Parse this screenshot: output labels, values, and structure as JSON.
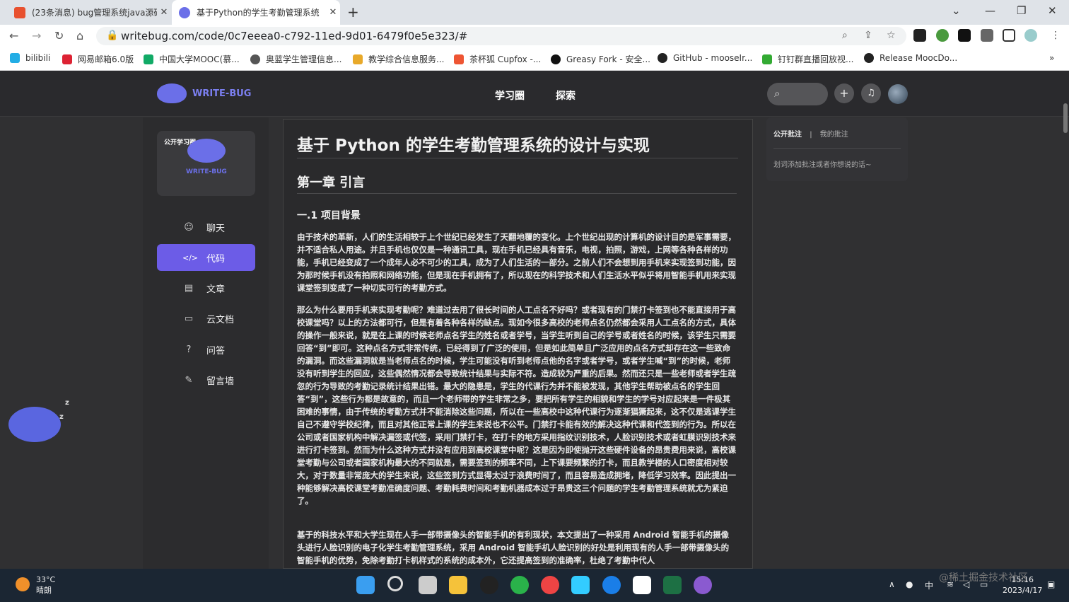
{
  "browser": {
    "tabs": [
      {
        "title": "(23条消息) bug管理系统java源码",
        "close": "✕"
      },
      {
        "title": "基于Python的学生考勤管理系统",
        "close": "✕"
      }
    ],
    "new_tab": "+",
    "url": "writebug.com/code/0c7eeea0-c792-11ed-9d01-6479f0e5e323/#",
    "bookmarks": [
      "bilibili",
      "网易邮箱6.0版",
      "中国大学MOOC(慕...",
      "奥蓝学生管理信息...",
      "教学综合信息服务...",
      "茶杯狐 Cupfox -...",
      "Greasy Fork - 安全...",
      "GitHub - mooseIr...",
      "钉钉群直播回放视...",
      "Release MoocDo..."
    ],
    "bookmarks_more": "»"
  },
  "site": {
    "logo_text": "WRITE-BUG",
    "nav": [
      "学习圈",
      "探索"
    ],
    "plus": "+",
    "bell": "🔔"
  },
  "sidebar": {
    "card_tag": "公开学习圈",
    "card_logo": "WRITE-BUG",
    "items": [
      {
        "label": "聊天",
        "icon": "chat-icon",
        "glyph": "☺"
      },
      {
        "label": "代码",
        "icon": "code-icon",
        "glyph": "</>"
      },
      {
        "label": "文章",
        "icon": "article-icon",
        "glyph": "▤"
      },
      {
        "label": "云文档",
        "icon": "folder-icon",
        "glyph": "▭"
      },
      {
        "label": "问答",
        "icon": "question-icon",
        "glyph": "?"
      },
      {
        "label": "留言墙",
        "icon": "edit-icon",
        "glyph": "✎"
      }
    ],
    "active": "代码"
  },
  "article": {
    "title": "基于 Python 的学生考勤管理系统的设计与实现",
    "chapter": "第一章 引言",
    "section": "一.1 项目背景",
    "paragraphs": [
      "由于技术的革新，人们的生活相较于上个世纪已经发生了天翻地覆的变化。上个世纪出现的计算机的设计目的是军事需要，并不适合私人用途。并且手机也仅仅是一种通讯工具，现在手机已经具有音乐，电视，拍照，游戏，上网等各种各样的功能，手机已经变成了一个成年人必不可少的工具，成为了人们生活的一部分。之前人们不会想到用手机来实现签到功能，因为那时候手机没有拍照和网络功能，但是现在手机拥有了，所以现在的科学技术和人们生活水平似乎将用智能手机用来实现课堂签到变成了一种切实可行的考勤方式。",
      "那么为什么要用手机来实现考勤呢？难道过去用了很长时间的人工点名不好吗？或者现有的门禁打卡签到也不能直接用于高校课堂吗？以上的方法都可行，但是有着各种各样的缺点。现如今很多高校的老师点名仍然都会采用人工点名的方式，具体的操作一般来说，就是在上课的时候老师点名学生的姓名或者学号，当学生听到自己的学号或者姓名的时候，该学生只需要回答“到”即可。这种点名方式非常传统，已经得到了广泛的使用，但是如此简单且广泛应用的点名方式却存在这一些致命的漏洞。而这些漏洞就是当老师点名的时候，学生可能没有听到老师点他的名字或者学号，或者学生喊“到”的时候，老师没有听到学生的回应，这些偶然情况都会导致统计结果与实际不符。造成较为严重的后果。然而还只是一些老师或者学生疏忽的行为导致的考勤记录统计结果出错。最大的隐患是，学生的代课行为并不能被发现，其他学生帮助被点名的学生回答“到”，这些行为都是故意的，而且一个老师带的学生非常之多，要把所有学生的相貌和学生的学号对应起来是一件极其困难的事情，由于传统的考勤方式并不能消除这些问题，所以在一些高校中这种代课行为逐渐猖獗起来，这不仅是逃课学生自己不遵守学校纪律，而且对其他正常上课的学生来说也不公平。门禁打卡能有效的解决这种代课和代签到的行为。所以在公司或者国家机构中解决漏签或代签，采用门禁打卡，在打卡的地方采用指纹识别技术，人脸识别技术或者虹膜识别技术来进行打卡签到。然而为什么这种方式并没有应用到高校课堂中呢？这是因为即使抛开这些硬件设备的昂贵费用来说，高校课堂考勤与公司或者国家机构最大的不同就是，需要签到的频率不同，上下课要频繁的打卡，而且教学楼的人口密度相对较大，对于数量非常庞大的学生来说，这些签到方式显得太过于浪费时间了，而且容易造成拥堵，降低学习效率。因此提出一种能够解决高校课堂考勤准确度问题、考勤耗费时间和考勤机器成本过于昂贵这三个问题的学生考勤管理系统就尤为紧迫了。",
      "基于的科技水平和大学生现在人手一部带摄像头的智能手机的有利现状，本文提出了一种采用 Android 智能手机的摄像头进行人脸识别的电子化学生考勤管理系统，采用 Android 智能手机人脸识别的好处是利用现有的人手一部带摄像头的智能手机的优势，免除考勤打卡机样式的系统的成本外，它还提高签到的准确率，杜绝了考勤中代人"
    ]
  },
  "annotations": {
    "tab_public": "公开批注",
    "separator": "|",
    "tab_mine": "我的批注",
    "hint": "划词添加批注或者你想说的话~"
  },
  "taskbar": {
    "temp": "33°C",
    "weather": "晴朗",
    "ime": "中",
    "time": "15:16",
    "date": "2023/4/17",
    "watermark": "@稀土掘金技术社区"
  }
}
